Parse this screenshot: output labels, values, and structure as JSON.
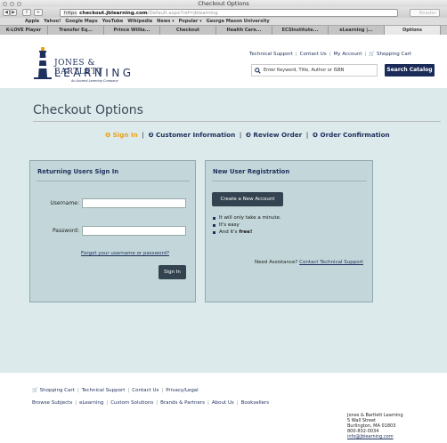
{
  "window": {
    "title": "Checkout Options"
  },
  "toolbar": {
    "back": "◀",
    "forward": "▶",
    "share": "⇪",
    "add": "+",
    "url_scheme": "https",
    "url_host": "checkout.jblearning.com",
    "url_path": "/Default.aspx?ref=jblearning",
    "reader": "Reader"
  },
  "bookmarks": [
    "Apple",
    "Yahoo!",
    "Google Maps",
    "YouTube",
    "Wikipedia",
    "News ▾",
    "Popular ▾",
    "George Mason University"
  ],
  "tabs": [
    "K-LOVE Player",
    "Transfer Eq...",
    "Prince Willia...",
    "Checkout",
    "Health Care...",
    "ECSInstitute...",
    "eLearning |...",
    "Options"
  ],
  "brand": {
    "line1": "JONES & BARTLETT",
    "line2": "LEARNING",
    "line3": "An Ascend Learning Company"
  },
  "header_links": [
    "Technical Support",
    "Contact Us",
    "My Account",
    "Shopping Cart"
  ],
  "search": {
    "placeholder": "Enter Keyword, Title, Author or ISBN",
    "button": "Search Catalog"
  },
  "page_title": "Checkout Options",
  "steps": [
    {
      "num": "1",
      "label": "Sign In"
    },
    {
      "num": "2",
      "label": "Customer Information"
    },
    {
      "num": "3",
      "label": "Review Order"
    },
    {
      "num": "4",
      "label": "Order Confirmation"
    }
  ],
  "signin": {
    "title": "Returning Users Sign In",
    "username_label": "Username:",
    "username_value": "",
    "password_label": "Password:",
    "password_value": "",
    "forgot": "Forgot your username or password?",
    "button": "Sign In"
  },
  "register": {
    "title": "New User Registration",
    "button": "Create a New Account",
    "bullets": [
      "It will only take a minute.",
      "It's easy"
    ],
    "bullet3_prefix": "And it's",
    "bullet3_bold": "free!",
    "assist_prefix": "Need Assistance?",
    "assist_link": "Contact Technical Support"
  },
  "footer_row1": [
    "Shopping Cart",
    "Technical Support",
    "Contact Us",
    "Privacy/Legal"
  ],
  "footer_row2": [
    "Browse Subjects",
    "eLearning",
    "Custom Solutions",
    "Brands & Partners",
    "About Us",
    "Booksellers"
  ],
  "address": [
    "Jones & Bartlett Learning",
    "5 Wall Street",
    "Burlington, MA 01803",
    "800-832-0034",
    "info@jblearning.com"
  ],
  "colors": {
    "navy": "#1d2f5c",
    "accent": "#e8a21b",
    "panel": "#ddeaeb",
    "box": "#c3d7da",
    "button": "#33434f"
  }
}
